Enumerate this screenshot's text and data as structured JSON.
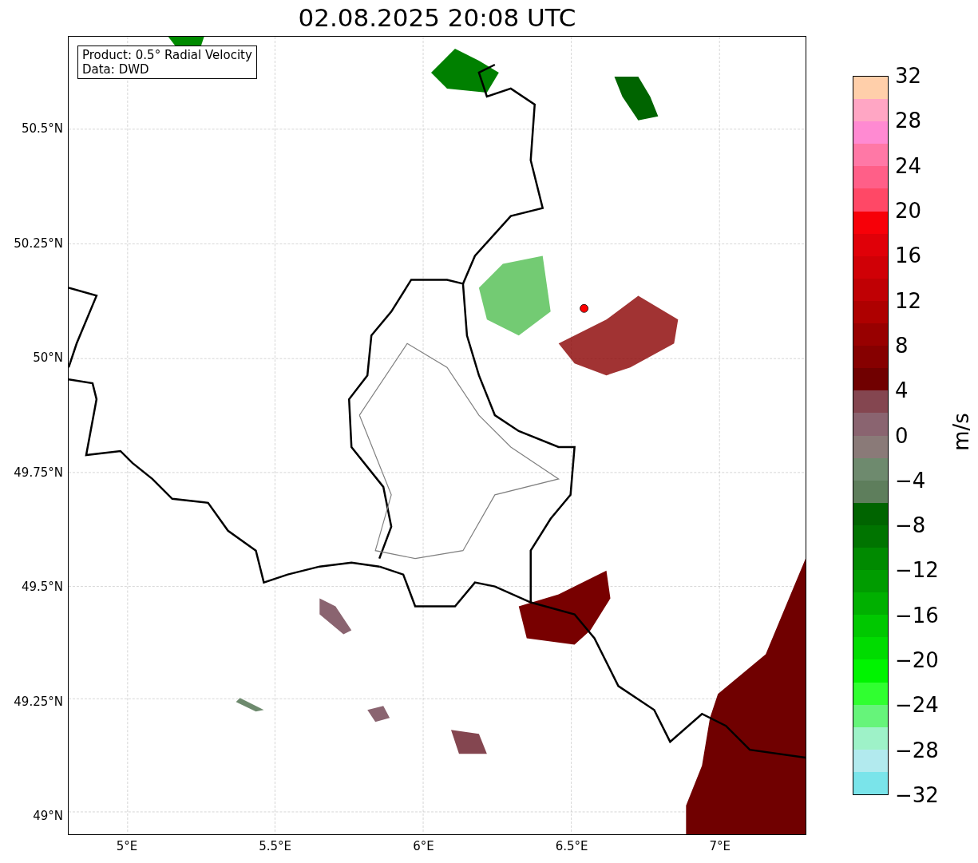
{
  "title": "02.08.2025 20:08 UTC",
  "legend": {
    "lines": [
      "Product: 0.5° Radial Velocity",
      "Data: DWD"
    ]
  },
  "map": {
    "lat_labels": [
      "50.5°N",
      "50.25°N",
      "50°N",
      "49.75°N",
      "49.5°N",
      "49.25°N",
      "49°N"
    ],
    "lon_labels": [
      "5°E",
      "5.5°E",
      "6°E",
      "6.5°E",
      "7°E"
    ]
  },
  "colorbar": {
    "label": "m/s",
    "ticks": [
      "32",
      "28",
      "24",
      "20",
      "16",
      "12",
      "8",
      "4",
      "0",
      "−4",
      "−8",
      "−12",
      "−16",
      "−20",
      "−24",
      "−28",
      "−32"
    ],
    "bands": [
      {
        "color": "#ffcfaa"
      },
      {
        "color": "#ffa6c4"
      },
      {
        "color": "#ff8ad2"
      },
      {
        "color": "#ff78a6"
      },
      {
        "color": "#ff5f88"
      },
      {
        "color": "#ff4866"
      },
      {
        "color": "#f70008"
      },
      {
        "color": "#e00008"
      },
      {
        "color": "#d00006"
      },
      {
        "color": "#c00004"
      },
      {
        "color": "#ae0000"
      },
      {
        "color": "#980000"
      },
      {
        "color": "#860000"
      },
      {
        "color": "#700000"
      },
      {
        "color": "#844650"
      },
      {
        "color": "#8a6470"
      },
      {
        "color": "#8a7a78"
      },
      {
        "color": "#6e8a6e"
      },
      {
        "color": "#5e7e5c"
      },
      {
        "color": "#006400"
      },
      {
        "color": "#007400"
      },
      {
        "color": "#008a00"
      },
      {
        "color": "#009c00"
      },
      {
        "color": "#00b000"
      },
      {
        "color": "#00c800"
      },
      {
        "color": "#00dc00"
      },
      {
        "color": "#00f400"
      },
      {
        "color": "#30ff30"
      },
      {
        "color": "#66f47a"
      },
      {
        "color": "#9ef2c8"
      },
      {
        "color": "#b2eaee"
      },
      {
        "color": "#7ae4ea"
      }
    ]
  }
}
